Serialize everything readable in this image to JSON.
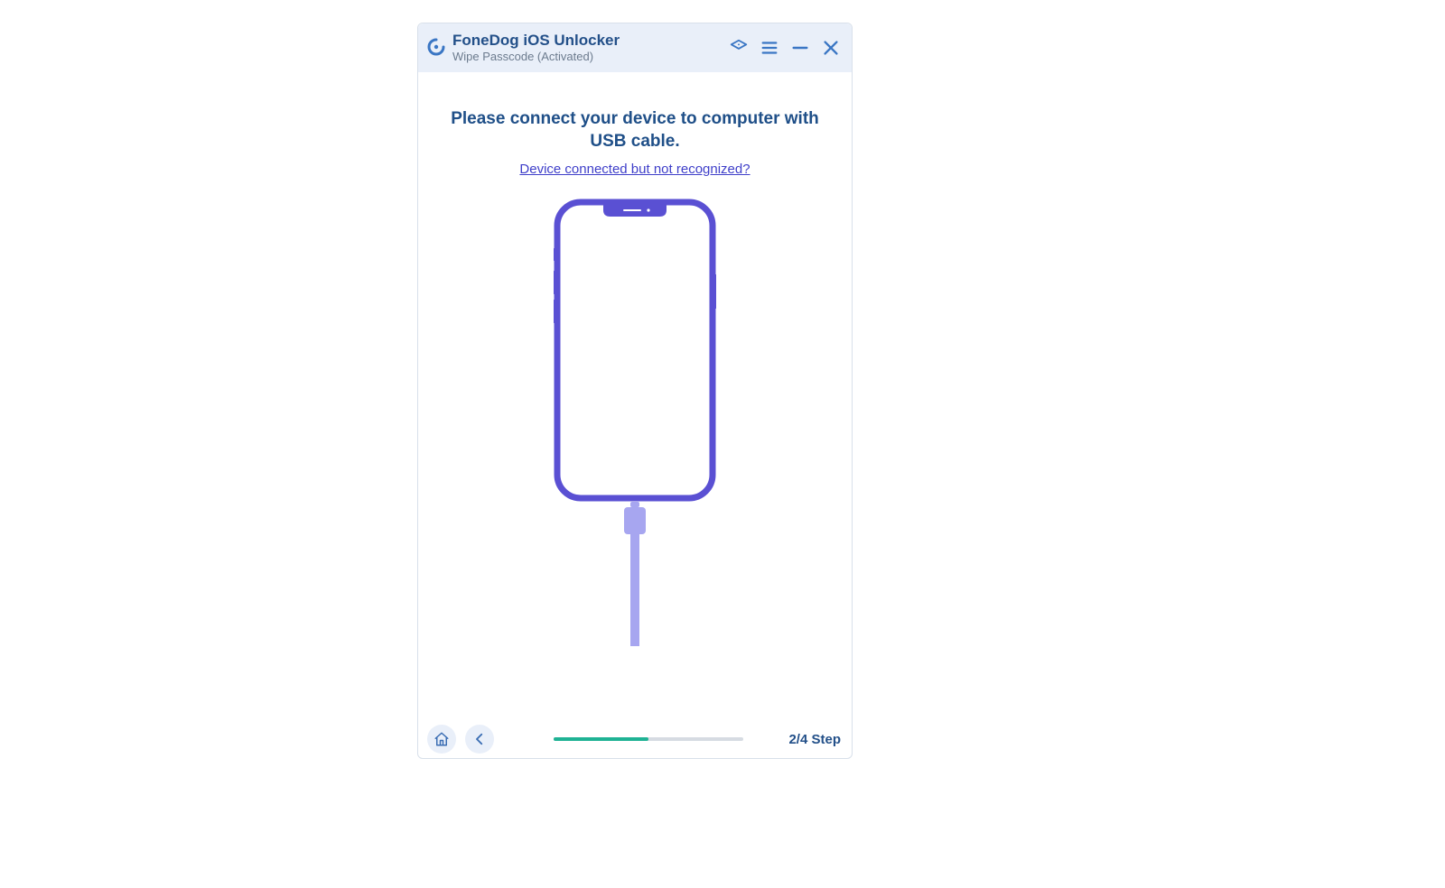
{
  "titlebar": {
    "app_name": "FoneDog iOS Unlocker",
    "subtitle": "Wipe Passcode  (Activated)"
  },
  "main": {
    "instruction": "Please connect your device to computer with USB cable.",
    "help_link": "Device connected but not recognized?"
  },
  "footer": {
    "step_label": "2/4 Step",
    "progress_fraction": 0.5
  },
  "colors": {
    "accent_blue": "#235089",
    "link_violet": "#3f3fc9",
    "device_violet": "#5a50d3",
    "device_violet_light": "#a7a6f0",
    "progress_green": "#1fb294",
    "titlebar_bg": "#e9eff9"
  }
}
